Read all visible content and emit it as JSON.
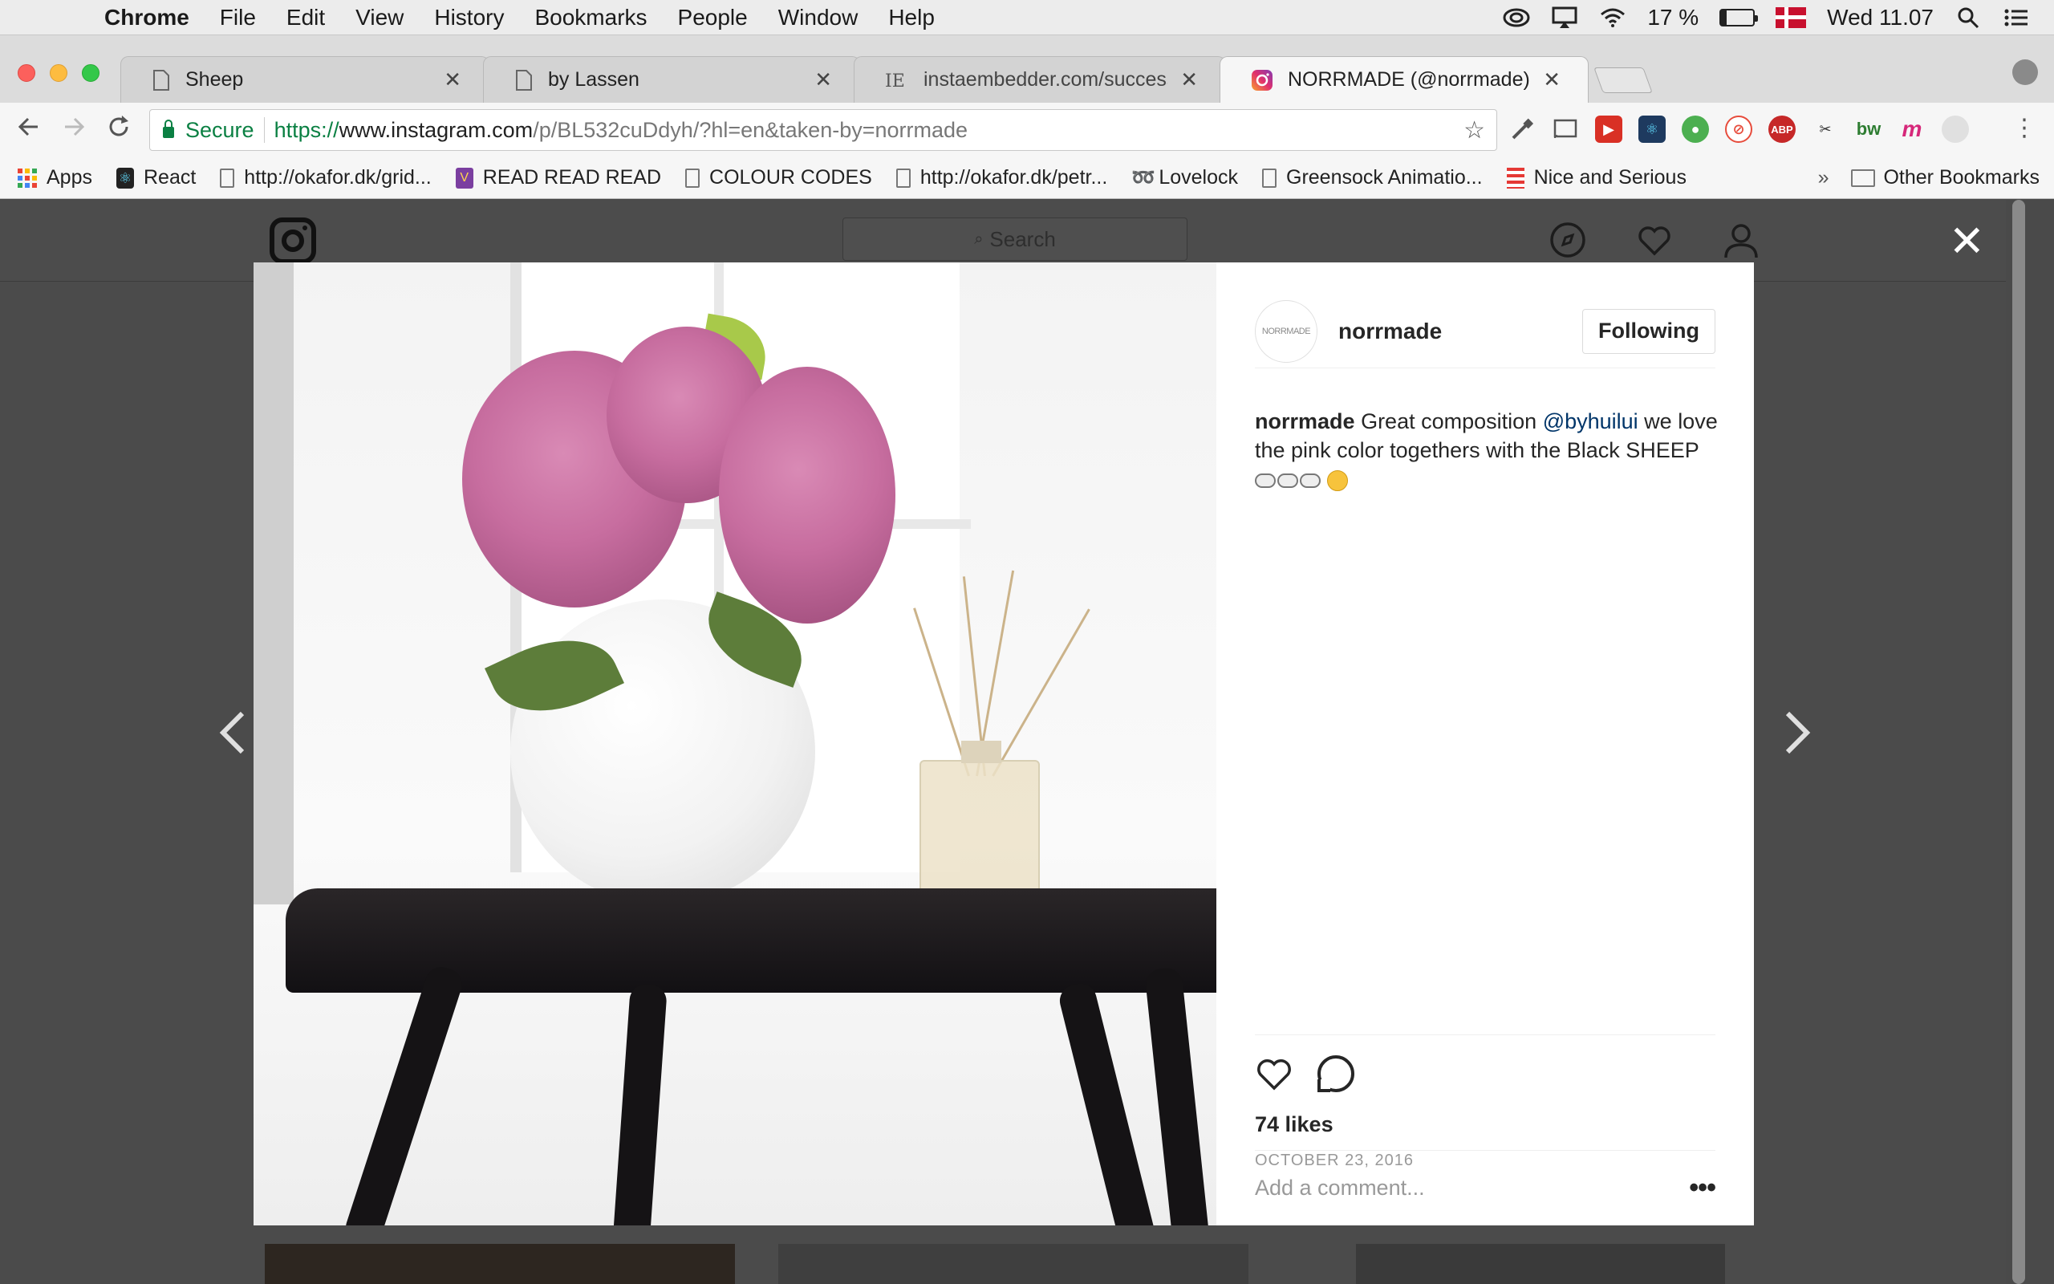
{
  "menubar": {
    "app_name": "Chrome",
    "items": [
      "File",
      "Edit",
      "View",
      "History",
      "Bookmarks",
      "People",
      "Window",
      "Help"
    ],
    "battery_text": "17 %",
    "battery_level": 0.17,
    "clock": "Wed 11.07"
  },
  "tabs": [
    {
      "title": "Sheep",
      "icon": "page-icon",
      "active": false
    },
    {
      "title": "by Lassen",
      "icon": "page-icon",
      "active": false
    },
    {
      "title": "instaembedder.com/success.p",
      "icon": "instaembedder-icon",
      "active": false
    },
    {
      "title": "NORRMADE (@norrmade) • Ins",
      "icon": "instagram-icon",
      "active": true
    }
  ],
  "omnibox": {
    "secure_label": "Secure",
    "scheme": "https://",
    "host": "www.instagram.com",
    "path": "/p/BL532cuDdyh/?hl=en&taken-by=norrmade"
  },
  "bookmarks": [
    {
      "label": "Apps",
      "icon": "apps-grid-icon"
    },
    {
      "label": "React",
      "icon": "react-icon"
    },
    {
      "label": "http://okafor.dk/grid...",
      "icon": "page-icon"
    },
    {
      "label": "READ READ READ",
      "icon": "read-icon"
    },
    {
      "label": "COLOUR CODES",
      "icon": "page-icon"
    },
    {
      "label": "http://okafor.dk/petr...",
      "icon": "page-icon"
    },
    {
      "label": "Lovelock",
      "icon": "lovelock-icon"
    },
    {
      "label": "Greensock Animatio...",
      "icon": "page-icon"
    },
    {
      "label": "Nice and Serious",
      "icon": "nice-serious-icon"
    }
  ],
  "bookmarks_overflow": "»",
  "other_bookmarks": "Other Bookmarks",
  "instagram": {
    "search_placeholder": "Search"
  },
  "post": {
    "username": "norrmade",
    "avatar_text": "NORRMADE",
    "follow_label": "Following",
    "caption_user": "norrmade",
    "caption_before": "Great composition",
    "caption_mention": "@byhuilui",
    "caption_after": "we love the pink color togethers with the Black SHEEP",
    "likes": "74 likes",
    "date": "OCTOBER 23, 2016",
    "comment_placeholder": "Add a comment...",
    "more_label": "•••"
  },
  "colors": {
    "secure_green": "#0b8043",
    "mention_blue": "#003569",
    "overlay": "#4b4b4b"
  }
}
